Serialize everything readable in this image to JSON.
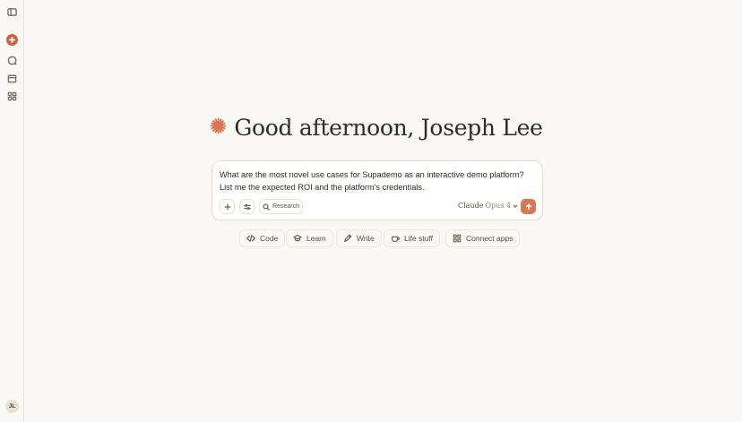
{
  "greeting": {
    "text": "Good afternoon, Joseph Lee"
  },
  "composer": {
    "prompt_line1": "What are the most novel use cases for Supademo as an interactive demo platform?",
    "prompt_line2": "List me the expected ROI and the platform's credentials.",
    "research_label": "Research",
    "model_name": "Claude",
    "model_version": "Opus 4"
  },
  "chips": [
    {
      "label": "Code",
      "icon": "code-icon"
    },
    {
      "label": "Learn",
      "icon": "graduation-cap-icon"
    },
    {
      "label": "Write",
      "icon": "pencil-icon"
    },
    {
      "label": "Life stuff",
      "icon": "coffee-cup-icon"
    },
    {
      "label": "Connect apps",
      "icon": "grid-icon"
    }
  ],
  "user": {
    "initials": "JL"
  },
  "colors": {
    "accent": "#d97757",
    "brand": "#c96442",
    "background": "#faf9f5"
  }
}
